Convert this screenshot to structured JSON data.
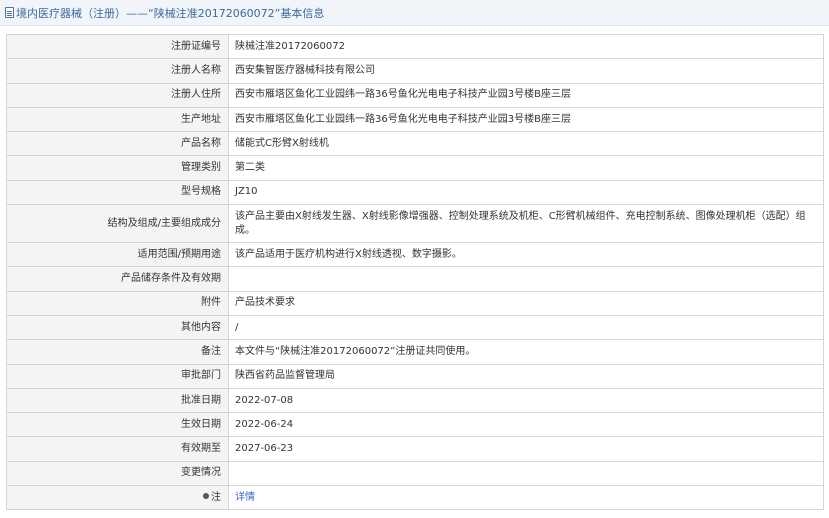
{
  "header": {
    "title": "境内医疗器械（注册）——“陕械注准20172060072”基本信息",
    "icon": "document-icon"
  },
  "rows": [
    {
      "label": "注册证编号",
      "value": "陕械注准20172060072"
    },
    {
      "label": "注册人名称",
      "value": "西安集智医疗器械科技有限公司"
    },
    {
      "label": "注册人住所",
      "value": "西安市雁塔区鱼化工业园纬一路36号鱼化光电电子科技产业园3号楼B座三层"
    },
    {
      "label": "生产地址",
      "value": "西安市雁塔区鱼化工业园纬一路36号鱼化光电电子科技产业园3号楼B座三层"
    },
    {
      "label": "产品名称",
      "value": "储能式C形臂X射线机"
    },
    {
      "label": "管理类别",
      "value": "第二类"
    },
    {
      "label": "型号规格",
      "value": "JZ10"
    },
    {
      "label": "结构及组成/主要组成成分",
      "value": "该产品主要由X射线发生器、X射线影像增强器、控制处理系统及机柜、C形臂机械组件、充电控制系统、图像处理机柜（选配）组成。"
    },
    {
      "label": "适用范围/预期用途",
      "value": "该产品适用于医疗机构进行X射线透视、数字摄影。"
    },
    {
      "label": "产品储存条件及有效期",
      "value": ""
    },
    {
      "label": "附件",
      "value": "产品技术要求"
    },
    {
      "label": "其他内容",
      "value": "/"
    },
    {
      "label": "备注",
      "value": "本文件与“陕械注准20172060072”注册证共同使用。"
    },
    {
      "label": "审批部门",
      "value": "陕西省药品监督管理局"
    },
    {
      "label": "批准日期",
      "value": "2022-07-08"
    },
    {
      "label": "生效日期",
      "value": "2022-06-24"
    },
    {
      "label": "有效期至",
      "value": "2027-06-23"
    },
    {
      "label": "变更情况",
      "value": ""
    }
  ],
  "note": {
    "label": "注",
    "icon": "pin-icon",
    "link_text": "详情"
  }
}
